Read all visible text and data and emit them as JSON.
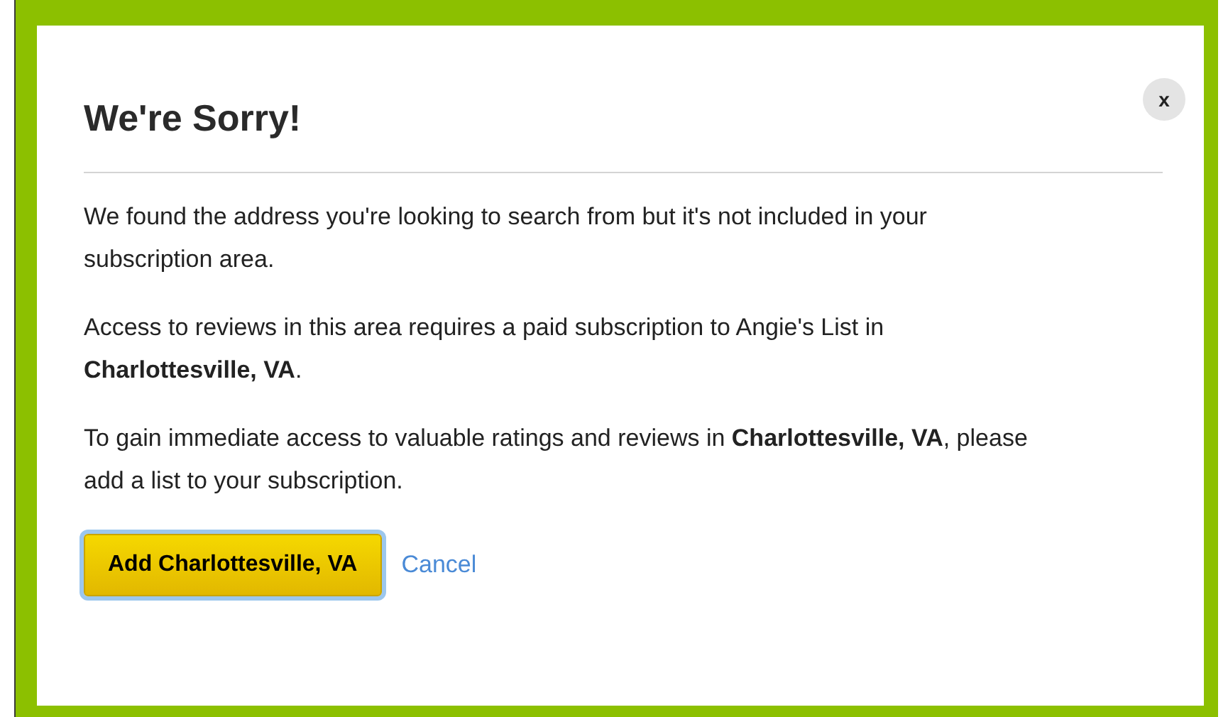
{
  "dialog": {
    "title": "We're Sorry!",
    "close_label": "x",
    "paragraphs": [
      "We found the address you're looking to search from but it's not included in your subscription area.",
      "Access to reviews in this area requires a paid subscription to Angie's List in **Charlottesville, VA**.",
      "To gain immediate access to valuable ratings and reviews in **Charlottesville, VA**, please add a list to your subscription."
    ],
    "primary_button": {
      "label": "Add Charlottesville, VA",
      "focused": true
    },
    "cancel_link": "Cancel"
  }
}
